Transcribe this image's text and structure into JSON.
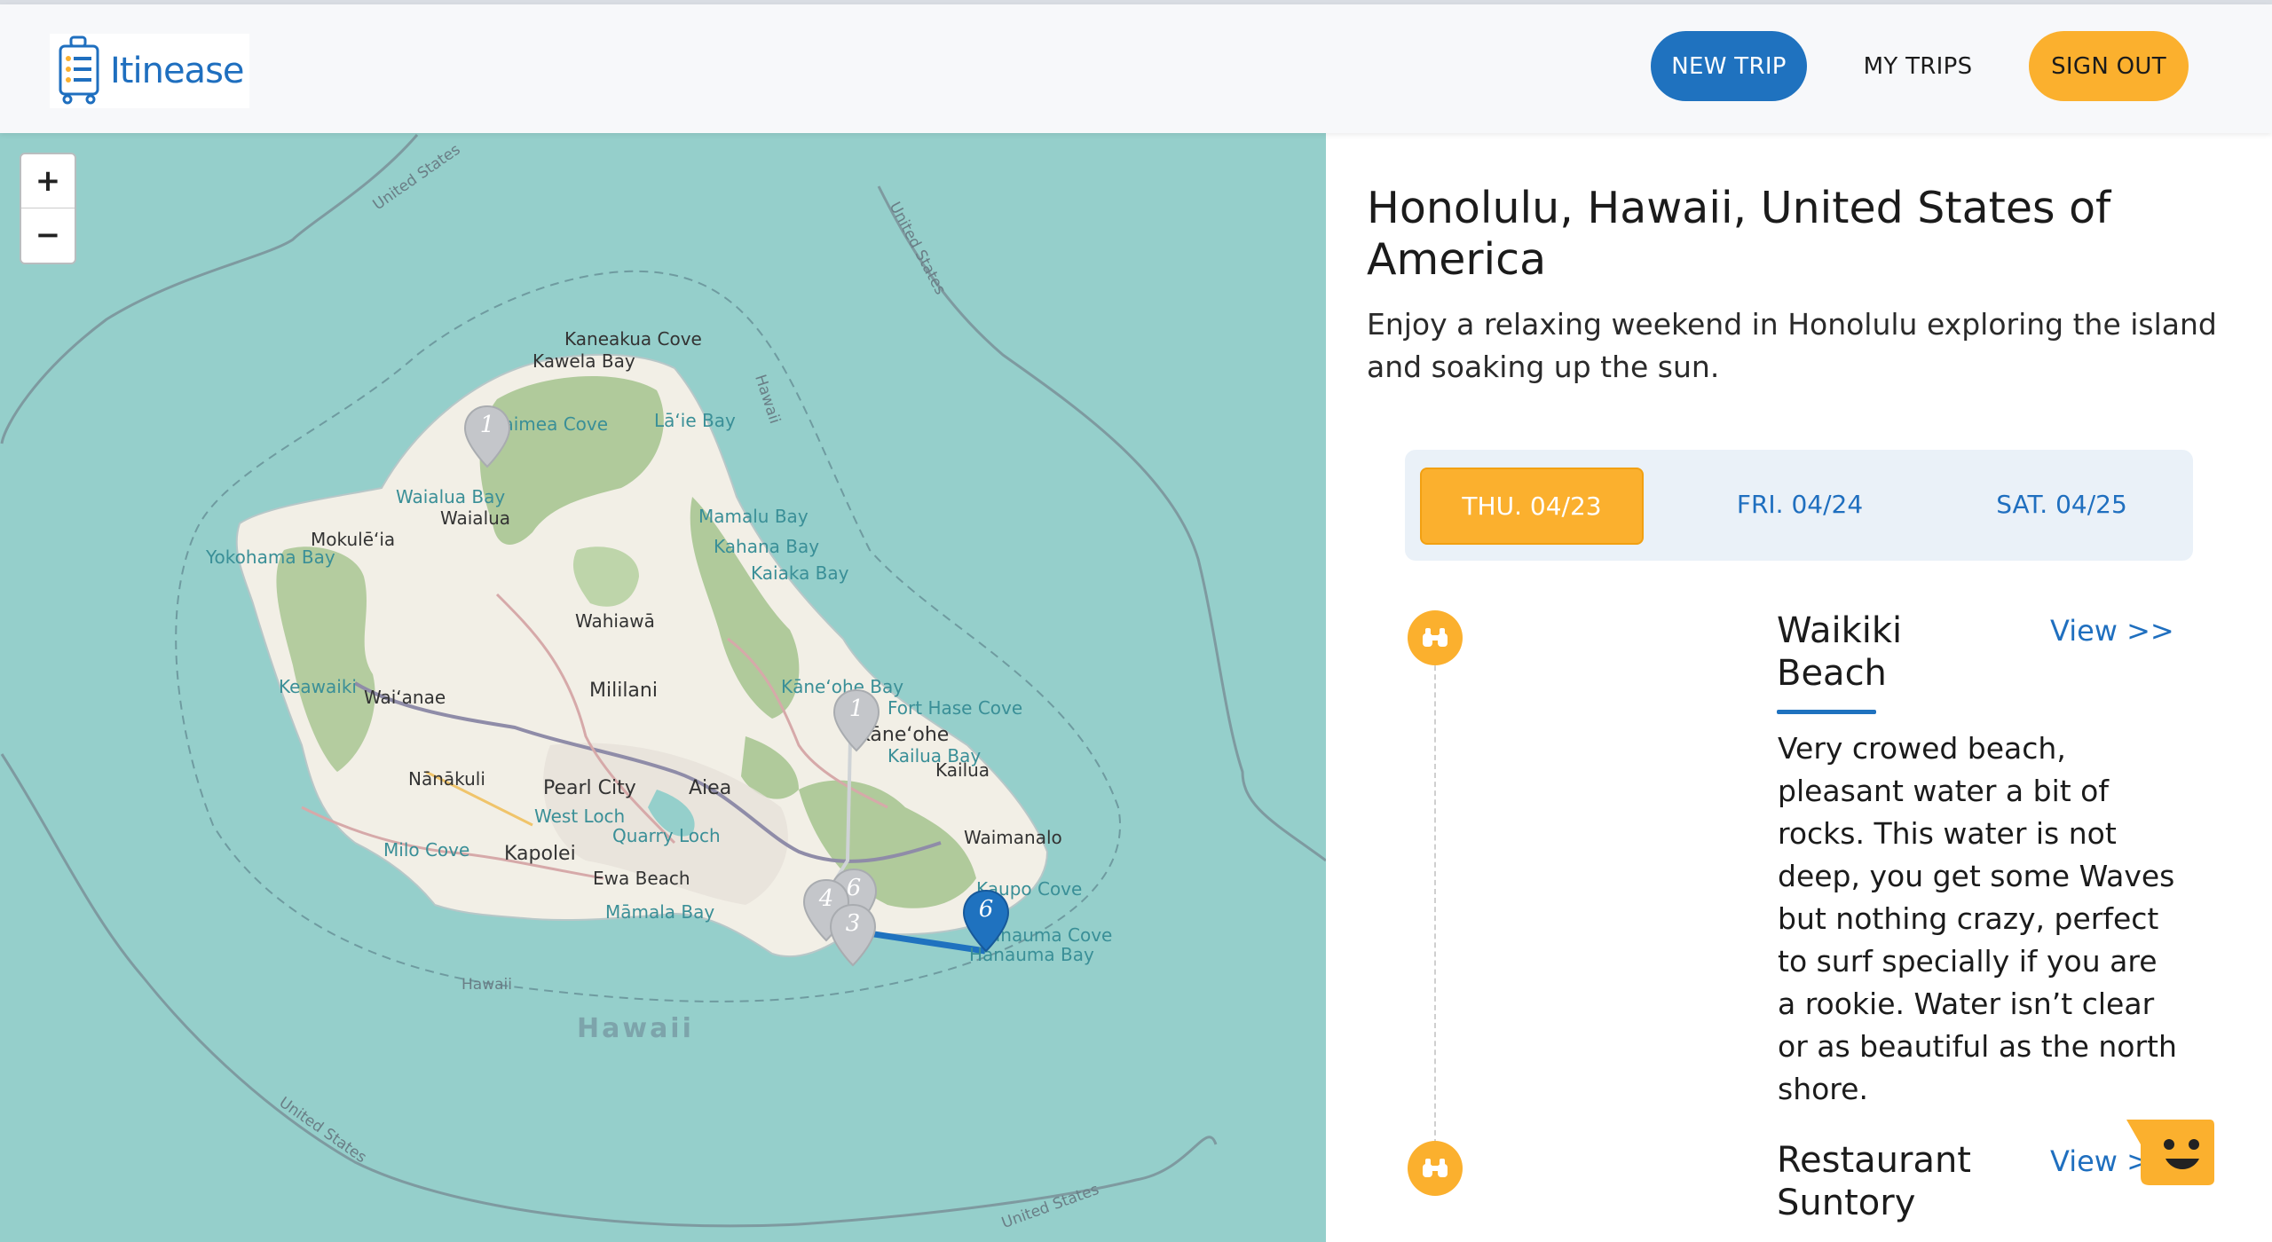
{
  "brand": {
    "name": "Itinease"
  },
  "nav": {
    "new_trip": "NEW TRIP",
    "my_trips": "MY TRIPS",
    "sign_out": "SIGN OUT"
  },
  "map": {
    "zoom_in": "+",
    "zoom_out": "−",
    "labels": {
      "kaneakua_cove": "Kaneakua Cove",
      "kawela_bay": "Kawela Bay",
      "waimea_cove": "Waimea Cove",
      "laie_bay": "Lā‘ie Bay",
      "hawaii_coast": "Hawaii",
      "waialua_bay": "Waialua Bay",
      "waialua": "Waialua",
      "mokuleia": "Mokulē‘ia",
      "yokohama_bay": "Yokohama Bay",
      "mamalu_bay": "Mamalu Bay",
      "kahana_bay": "Kahana Bay",
      "kaiaka_bay": "Kaiaka Bay",
      "wahiawa": "Wahiawā",
      "keawaiki": "Keawaiki",
      "waianae": "Wai‘anae",
      "mililani": "Mililani",
      "kaneohe_bay": "Kāne‘ohe Bay",
      "fort_hase_cove": "Fort Hase Cove",
      "kaneohe": "Kāne‘ohe",
      "kailua_bay": "Kailua Bay",
      "kailua": "Kailua",
      "nanakuli": "Nānākuli",
      "pearl_city": "Pearl City",
      "aiea": "Aiea",
      "west_loch": "West Loch",
      "quarry_loch": "Quarry Loch",
      "waimanalo": "Waimanalo",
      "milo_cove": "Milo Cove",
      "kapolei": "Kapolei",
      "ewa_beach": "Ewa Beach",
      "mamala_bay": "Māmala Bay",
      "kaupo_cove": "Kaupo Cove",
      "hanauma_cove": "Hanauma Cove",
      "hanauma_bay": "Hanauma Bay",
      "hawaii_south": "Hawaii",
      "hawaii_region": "Hawaii",
      "us_top": "United States",
      "us_right": "United States",
      "us_bottom_left": "United States",
      "us_bottom_right": "United States"
    },
    "markers": [
      {
        "label": "1",
        "color": "#c4c6ca"
      },
      {
        "label": "1",
        "color": "#c4c6ca"
      },
      {
        "label": "6",
        "color": "#c4c6ca"
      },
      {
        "label": "4",
        "color": "#c4c6ca"
      },
      {
        "label": "3",
        "color": "#c4c6ca"
      },
      {
        "label": "6",
        "color": "#1f72bf"
      }
    ]
  },
  "trip": {
    "destination": "Honolulu, Hawaii, United States of America",
    "description": "Enjoy a relaxing weekend in Honolulu exploring the island and soaking up the sun.",
    "days": [
      {
        "label": "THU. 04/23",
        "active": true
      },
      {
        "label": "FRI. 04/24",
        "active": false
      },
      {
        "label": "SAT. 04/25",
        "active": false
      }
    ],
    "activities": [
      {
        "icon": "binoculars-icon",
        "title": "Waikiki Beach",
        "view": "View >>",
        "description": "Very crowed beach, pleasant water a bit of rocks. This water is not deep, you get some Waves but nothing crazy, perfect to surf specially if you are a rookie. Water isn’t clear or as beautiful as the north shore."
      },
      {
        "icon": "binoculars-icon",
        "title": "Restaurant Suntory",
        "view": "View >>",
        "description": ""
      }
    ]
  },
  "colors": {
    "primary": "#1f72bf",
    "accent": "#fbb02e",
    "water": "#95cfcb",
    "land": "#f2efe6",
    "forest": "#a9c592"
  }
}
